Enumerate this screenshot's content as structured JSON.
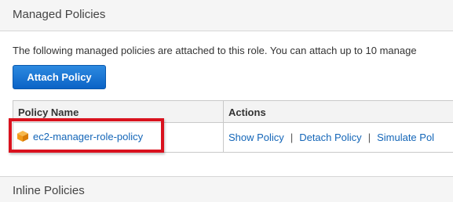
{
  "managed_policies": {
    "title": "Managed Policies",
    "description": "The following managed policies are attached to this role. You can attach up to 10 manage",
    "attach_button_label": "Attach Policy",
    "table": {
      "columns": [
        "Policy Name",
        "Actions"
      ],
      "rows": [
        {
          "policy_name": "ec2-manager-role-policy",
          "actions": [
            "Show Policy",
            "Detach Policy",
            "Simulate Pol"
          ],
          "separator": "|"
        }
      ]
    }
  },
  "inline_policies": {
    "title": "Inline Policies"
  },
  "colors": {
    "link": "#1466b8",
    "button": "#0b63c6",
    "highlight": "#d9121e",
    "policy_icon": "#f29a1a"
  },
  "icons": {
    "policy_icon": "orange-cube-icon"
  }
}
